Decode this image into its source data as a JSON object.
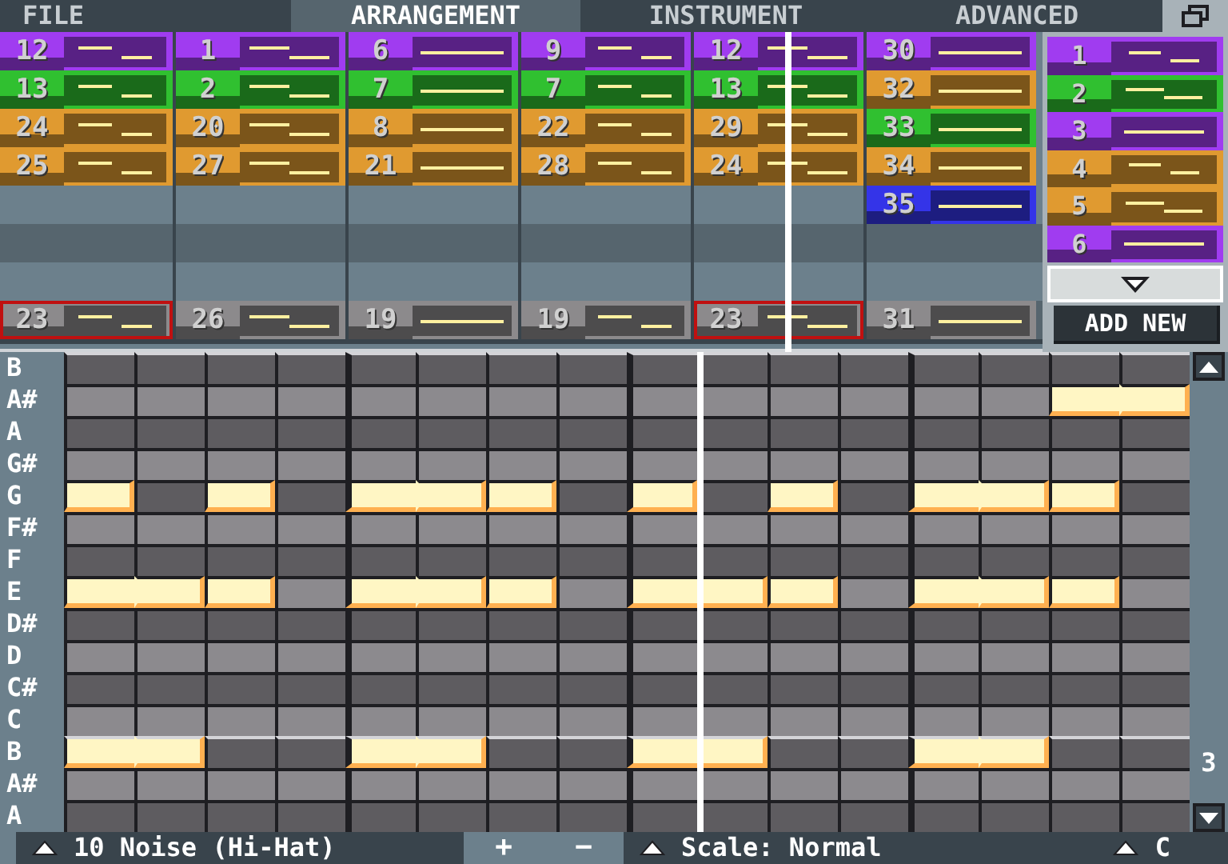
{
  "tabs": [
    {
      "label": "FILE",
      "selected": false
    },
    {
      "label": "ARRANGEMENT",
      "selected": true
    },
    {
      "label": "INSTRUMENT",
      "selected": false
    },
    {
      "label": "ADVANCED",
      "selected": false
    }
  ],
  "arrangement": {
    "playhead": {
      "level": 0.761
    },
    "channels": [
      {
        "cells": [
          {
            "kind": "pattern",
            "number": "12",
            "color": "#a03cf0",
            "selected": false
          },
          {
            "kind": "pattern",
            "number": "1",
            "color": "#a03cf0",
            "selected": false
          },
          {
            "kind": "pattern",
            "number": "6",
            "color": "#a03cf0",
            "selected": false
          },
          {
            "kind": "pattern",
            "number": "9",
            "color": "#a03cf0",
            "selected": false
          },
          {
            "kind": "pattern",
            "number": "12",
            "color": "#a03cf0",
            "selected": false
          },
          {
            "kind": "pattern",
            "number": "30",
            "color": "#a03cf0",
            "selected": false
          }
        ]
      },
      {
        "cells": [
          {
            "kind": "pattern",
            "number": "13",
            "color": "#30c030",
            "selected": false
          },
          {
            "kind": "pattern",
            "number": "2",
            "color": "#30c030",
            "selected": false
          },
          {
            "kind": "pattern",
            "number": "7",
            "color": "#30c030",
            "selected": false
          },
          {
            "kind": "pattern",
            "number": "7",
            "color": "#30c030",
            "selected": false
          },
          {
            "kind": "pattern",
            "number": "13",
            "color": "#30c030",
            "selected": false
          },
          {
            "kind": "pattern",
            "number": "32",
            "color": "#e09a30",
            "selected": false
          }
        ]
      },
      {
        "cells": [
          {
            "kind": "pattern",
            "number": "24",
            "color": "#e09a30",
            "selected": false
          },
          {
            "kind": "pattern",
            "number": "20",
            "color": "#e09a30",
            "selected": false
          },
          {
            "kind": "pattern",
            "number": "8",
            "color": "#e09a30",
            "selected": false
          },
          {
            "kind": "pattern",
            "number": "22",
            "color": "#e09a30",
            "selected": false
          },
          {
            "kind": "pattern",
            "number": "29",
            "color": "#e09a30",
            "selected": false
          },
          {
            "kind": "pattern",
            "number": "33",
            "color": "#30c030",
            "selected": false
          }
        ]
      },
      {
        "cells": [
          {
            "kind": "pattern",
            "number": "25",
            "color": "#e09a30",
            "selected": false
          },
          {
            "kind": "pattern",
            "number": "27",
            "color": "#e09a30",
            "selected": false
          },
          {
            "kind": "pattern",
            "number": "21",
            "color": "#e09a30",
            "selected": false
          },
          {
            "kind": "pattern",
            "number": "28",
            "color": "#e09a30",
            "selected": false
          },
          {
            "kind": "pattern",
            "number": "24",
            "color": "#e09a30",
            "selected": false
          },
          {
            "kind": "pattern",
            "number": "34",
            "color": "#e09a30",
            "selected": false
          }
        ]
      },
      {
        "cells": [
          {
            "kind": "empty",
            "selected": false
          },
          {
            "kind": "empty",
            "selected": false
          },
          {
            "kind": "empty",
            "selected": false
          },
          {
            "kind": "empty",
            "selected": false
          },
          {
            "kind": "empty",
            "selected": false
          },
          {
            "kind": "pattern",
            "number": "35",
            "color": "#3434e8",
            "selected": false
          }
        ]
      },
      {
        "cells": [
          {
            "kind": "empty",
            "selected": false
          },
          {
            "kind": "empty",
            "selected": false
          },
          {
            "kind": "empty",
            "selected": false
          },
          {
            "kind": "empty",
            "selected": false
          },
          {
            "kind": "empty",
            "selected": false
          },
          {
            "kind": "empty",
            "selected": false
          }
        ]
      },
      {
        "cells": [
          {
            "kind": "empty",
            "selected": false
          },
          {
            "kind": "empty",
            "selected": false
          },
          {
            "kind": "empty",
            "selected": false
          },
          {
            "kind": "empty",
            "selected": false
          },
          {
            "kind": "empty",
            "selected": false
          },
          {
            "kind": "empty",
            "selected": false
          }
        ]
      },
      {
        "cells": [
          {
            "kind": "pattern",
            "number": "23",
            "color": "#8c8a8c",
            "selected": true
          },
          {
            "kind": "pattern",
            "number": "26",
            "color": "#8c8a8c",
            "selected": false
          },
          {
            "kind": "pattern",
            "number": "19",
            "color": "#8c8a8c",
            "selected": false
          },
          {
            "kind": "pattern",
            "number": "19",
            "color": "#8c8a8c",
            "selected": false
          },
          {
            "kind": "pattern",
            "number": "23",
            "color": "#8c8a8c",
            "selected": true
          },
          {
            "kind": "pattern",
            "number": "31",
            "color": "#8c8a8c",
            "selected": false
          }
        ]
      }
    ]
  },
  "pattern_list": {
    "items": [
      {
        "number": "1",
        "color": "#a03cf0"
      },
      {
        "number": "2",
        "color": "#30c030"
      },
      {
        "number": "3",
        "color": "#a03cf0"
      },
      {
        "number": "4",
        "color": "#e09a30"
      },
      {
        "number": "5",
        "color": "#e09a30"
      },
      {
        "number": "6",
        "color": "#a03cf0"
      }
    ],
    "add_button": "ADD NEW"
  },
  "piano_roll": {
    "octave": "3",
    "keys": [
      {
        "label": "B",
        "octave_line": true,
        "steps": [
          {
            "on": false
          },
          {
            "on": false
          },
          {
            "on": false
          },
          {
            "on": false
          },
          {
            "on": false
          },
          {
            "on": false
          },
          {
            "on": false
          },
          {
            "on": false
          },
          {
            "on": false
          },
          {
            "on": false
          },
          {
            "on": false
          },
          {
            "on": false
          },
          {
            "on": false
          },
          {
            "on": false
          },
          {
            "on": false
          },
          {
            "on": false
          }
        ]
      },
      {
        "label": "A#",
        "octave_line": false,
        "steps": [
          {
            "on": false
          },
          {
            "on": false
          },
          {
            "on": false
          },
          {
            "on": false
          },
          {
            "on": false
          },
          {
            "on": false
          },
          {
            "on": false
          },
          {
            "on": false
          },
          {
            "on": false
          },
          {
            "on": false
          },
          {
            "on": false
          },
          {
            "on": false
          },
          {
            "on": false
          },
          {
            "on": false
          },
          {
            "on": true,
            "tied": false
          },
          {
            "on": true,
            "tied": true
          }
        ]
      },
      {
        "label": "A",
        "octave_line": false,
        "steps": [
          {
            "on": false
          },
          {
            "on": false
          },
          {
            "on": false
          },
          {
            "on": false
          },
          {
            "on": false
          },
          {
            "on": false
          },
          {
            "on": false
          },
          {
            "on": false
          },
          {
            "on": false
          },
          {
            "on": false
          },
          {
            "on": false
          },
          {
            "on": false
          },
          {
            "on": false
          },
          {
            "on": false
          },
          {
            "on": false
          },
          {
            "on": false
          }
        ]
      },
      {
        "label": "G#",
        "octave_line": false,
        "steps": [
          {
            "on": false
          },
          {
            "on": false
          },
          {
            "on": false
          },
          {
            "on": false
          },
          {
            "on": false
          },
          {
            "on": false
          },
          {
            "on": false
          },
          {
            "on": false
          },
          {
            "on": false
          },
          {
            "on": false
          },
          {
            "on": false
          },
          {
            "on": false
          },
          {
            "on": false
          },
          {
            "on": false
          },
          {
            "on": false
          },
          {
            "on": false
          }
        ]
      },
      {
        "label": "G",
        "octave_line": false,
        "steps": [
          {
            "on": true,
            "tied": false
          },
          {
            "on": false
          },
          {
            "on": true,
            "tied": false
          },
          {
            "on": false
          },
          {
            "on": true,
            "tied": false
          },
          {
            "on": true,
            "tied": true
          },
          {
            "on": true,
            "tied": false
          },
          {
            "on": false
          },
          {
            "on": true,
            "tied": false
          },
          {
            "on": false
          },
          {
            "on": true,
            "tied": false
          },
          {
            "on": false
          },
          {
            "on": true,
            "tied": false
          },
          {
            "on": true,
            "tied": true
          },
          {
            "on": true,
            "tied": false
          },
          {
            "on": false
          }
        ]
      },
      {
        "label": "F#",
        "octave_line": false,
        "steps": [
          {
            "on": false
          },
          {
            "on": false
          },
          {
            "on": false
          },
          {
            "on": false
          },
          {
            "on": false
          },
          {
            "on": false
          },
          {
            "on": false
          },
          {
            "on": false
          },
          {
            "on": false
          },
          {
            "on": false
          },
          {
            "on": false
          },
          {
            "on": false
          },
          {
            "on": false
          },
          {
            "on": false
          },
          {
            "on": false
          },
          {
            "on": false
          }
        ]
      },
      {
        "label": "F",
        "octave_line": false,
        "steps": [
          {
            "on": false
          },
          {
            "on": false
          },
          {
            "on": false
          },
          {
            "on": false
          },
          {
            "on": false
          },
          {
            "on": false
          },
          {
            "on": false
          },
          {
            "on": false
          },
          {
            "on": false
          },
          {
            "on": false
          },
          {
            "on": false
          },
          {
            "on": false
          },
          {
            "on": false
          },
          {
            "on": false
          },
          {
            "on": false
          },
          {
            "on": false
          }
        ]
      },
      {
        "label": "E",
        "octave_line": false,
        "steps": [
          {
            "on": true,
            "tied": false
          },
          {
            "on": true,
            "tied": true
          },
          {
            "on": true,
            "tied": false
          },
          {
            "on": false
          },
          {
            "on": true,
            "tied": false
          },
          {
            "on": true,
            "tied": true
          },
          {
            "on": true,
            "tied": false
          },
          {
            "on": false
          },
          {
            "on": true,
            "tied": false
          },
          {
            "on": true,
            "tied": true
          },
          {
            "on": true,
            "tied": false
          },
          {
            "on": false
          },
          {
            "on": true,
            "tied": false
          },
          {
            "on": true,
            "tied": true
          },
          {
            "on": true,
            "tied": false
          },
          {
            "on": false
          }
        ]
      },
      {
        "label": "D#",
        "octave_line": false,
        "steps": [
          {
            "on": false
          },
          {
            "on": false
          },
          {
            "on": false
          },
          {
            "on": false
          },
          {
            "on": false
          },
          {
            "on": false
          },
          {
            "on": false
          },
          {
            "on": false
          },
          {
            "on": false
          },
          {
            "on": false
          },
          {
            "on": false
          },
          {
            "on": false
          },
          {
            "on": false
          },
          {
            "on": false
          },
          {
            "on": false
          },
          {
            "on": false
          }
        ]
      },
      {
        "label": "D",
        "octave_line": false,
        "steps": [
          {
            "on": false
          },
          {
            "on": false
          },
          {
            "on": false
          },
          {
            "on": false
          },
          {
            "on": false
          },
          {
            "on": false
          },
          {
            "on": false
          },
          {
            "on": false
          },
          {
            "on": false
          },
          {
            "on": false
          },
          {
            "on": false
          },
          {
            "on": false
          },
          {
            "on": false
          },
          {
            "on": false
          },
          {
            "on": false
          },
          {
            "on": false
          }
        ]
      },
      {
        "label": "C#",
        "octave_line": false,
        "steps": [
          {
            "on": false
          },
          {
            "on": false
          },
          {
            "on": false
          },
          {
            "on": false
          },
          {
            "on": false
          },
          {
            "on": false
          },
          {
            "on": false
          },
          {
            "on": false
          },
          {
            "on": false
          },
          {
            "on": false
          },
          {
            "on": false
          },
          {
            "on": false
          },
          {
            "on": false
          },
          {
            "on": false
          },
          {
            "on": false
          },
          {
            "on": false
          }
        ]
      },
      {
        "label": "C",
        "octave_line": false,
        "steps": [
          {
            "on": false
          },
          {
            "on": false
          },
          {
            "on": false
          },
          {
            "on": false
          },
          {
            "on": false
          },
          {
            "on": false
          },
          {
            "on": false
          },
          {
            "on": false
          },
          {
            "on": false
          },
          {
            "on": false
          },
          {
            "on": false
          },
          {
            "on": false
          },
          {
            "on": false
          },
          {
            "on": false
          },
          {
            "on": false
          },
          {
            "on": false
          }
        ]
      },
      {
        "label": "B",
        "octave_line": true,
        "steps": [
          {
            "on": true,
            "tied": false
          },
          {
            "on": true,
            "tied": true
          },
          {
            "on": false
          },
          {
            "on": false
          },
          {
            "on": true,
            "tied": false
          },
          {
            "on": true,
            "tied": true
          },
          {
            "on": false
          },
          {
            "on": false
          },
          {
            "on": true,
            "tied": false
          },
          {
            "on": true,
            "tied": true
          },
          {
            "on": false
          },
          {
            "on": false
          },
          {
            "on": true,
            "tied": false
          },
          {
            "on": true,
            "tied": true
          },
          {
            "on": false
          },
          {
            "on": false
          }
        ]
      },
      {
        "label": "A#",
        "octave_line": false,
        "steps": [
          {
            "on": false
          },
          {
            "on": false
          },
          {
            "on": false
          },
          {
            "on": false
          },
          {
            "on": false
          },
          {
            "on": false
          },
          {
            "on": false
          },
          {
            "on": false
          },
          {
            "on": false
          },
          {
            "on": false
          },
          {
            "on": false
          },
          {
            "on": false
          },
          {
            "on": false
          },
          {
            "on": false
          },
          {
            "on": false
          },
          {
            "on": false
          }
        ]
      },
      {
        "label": "A",
        "octave_line": false,
        "steps": [
          {
            "on": false
          },
          {
            "on": false
          },
          {
            "on": false
          },
          {
            "on": false
          },
          {
            "on": false
          },
          {
            "on": false
          },
          {
            "on": false
          },
          {
            "on": false
          },
          {
            "on": false
          },
          {
            "on": false
          },
          {
            "on": false
          },
          {
            "on": false
          },
          {
            "on": false
          },
          {
            "on": false
          },
          {
            "on": false
          },
          {
            "on": false
          }
        ]
      }
    ]
  },
  "bottom_bar": {
    "instrument": "10 Noise (Hi-Hat)",
    "plus": "+",
    "minus": "−",
    "scale": "Scale: Normal",
    "key": "C"
  }
}
